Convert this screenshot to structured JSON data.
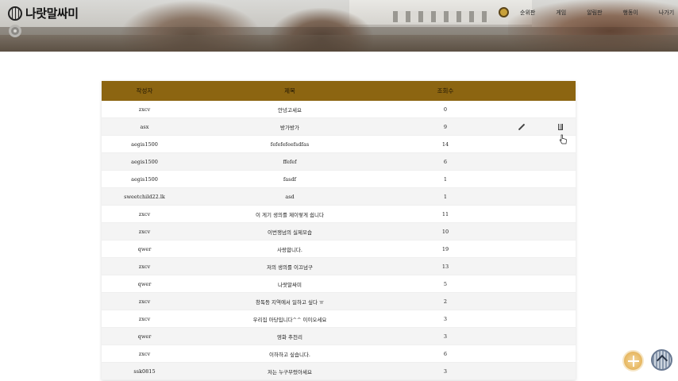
{
  "brand": {
    "logo_text": "나랏말싸미",
    "logo_icon": "globe-icon"
  },
  "nav": {
    "items": [
      {
        "label": "순위판"
      },
      {
        "label": "게임"
      },
      {
        "label": "알림판"
      },
      {
        "label": "행동이"
      },
      {
        "label": "나가기"
      }
    ],
    "medal_icon": "medal-icon"
  },
  "settings_icon": "gear-icon",
  "table": {
    "header_color": "#8c6511",
    "headers": {
      "author": "작성자",
      "title": "제목",
      "views": "조회수"
    },
    "rows": [
      {
        "author": "zxcv",
        "title": "안녕고세요",
        "views": "0"
      },
      {
        "author": "asx",
        "title": "방가방가",
        "views": "9",
        "editable": true
      },
      {
        "author": "aegis1500",
        "title": "fefefefeefsdfas",
        "views": "14"
      },
      {
        "author": "aegis1500",
        "title": "ffefef",
        "views": "6"
      },
      {
        "author": "aegis1500",
        "title": "fasdf",
        "views": "1"
      },
      {
        "author": "sweetchild22.lk",
        "title": "asd",
        "views": "1"
      },
      {
        "author": "zxcv",
        "title": "이 게기 생의를 제이렇게 쉽니다",
        "views": "11"
      },
      {
        "author": "zxcv",
        "title": "이번쟁넘의 실제모습",
        "views": "10"
      },
      {
        "author": "qwer",
        "title": "사랑합니다.",
        "views": "19"
      },
      {
        "author": "zxcv",
        "title": "저의 생의를 이끄넘구",
        "views": "13"
      },
      {
        "author": "qwer",
        "title": "나랏말싸미",
        "views": "5"
      },
      {
        "author": "zxcv",
        "title": "창독등 지역에서 일하고 싶다 ㅠ",
        "views": "2"
      },
      {
        "author": "zxcv",
        "title": "우리집 아당입니다^^ 이이오세요",
        "views": "3"
      },
      {
        "author": "qwer",
        "title": "영화 추천리",
        "views": "3"
      },
      {
        "author": "zxcv",
        "title": "이하하고 싶습니다.",
        "views": "6"
      },
      {
        "author": "ssk0815",
        "title": "저는 누구부렀아세요",
        "views": "3"
      }
    ]
  },
  "floating": {
    "add_icon": "plus-icon",
    "top_icon": "chevron-up-icon"
  }
}
